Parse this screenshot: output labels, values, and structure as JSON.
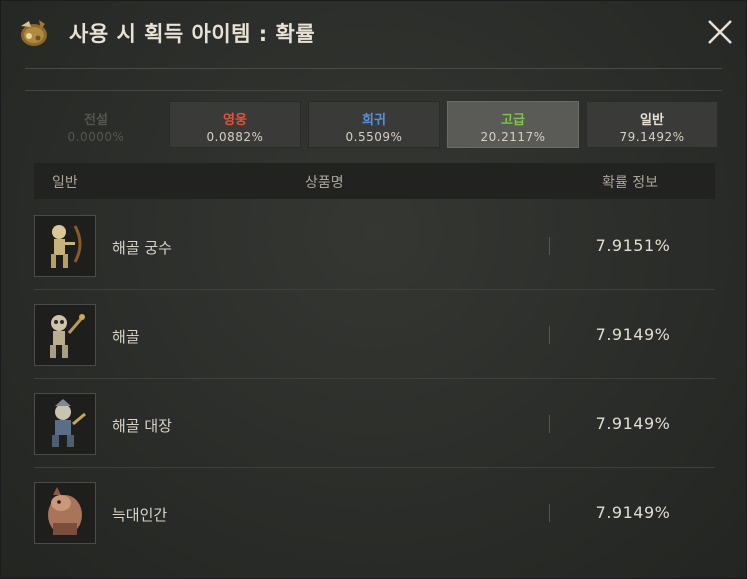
{
  "header": {
    "title": "사용 시 획득 아이템 : 확률",
    "icon": "item-bag-icon",
    "close_icon": "close-icon"
  },
  "tabs": [
    {
      "name": "전설",
      "pct": "0.0000%",
      "color": "#55564f",
      "state": "disabled"
    },
    {
      "name": "영웅",
      "pct": "0.0882%",
      "color": "#e0533a",
      "state": "normal"
    },
    {
      "name": "희귀",
      "pct": "0.5509%",
      "color": "#5a8fe0",
      "state": "normal"
    },
    {
      "name": "고급",
      "pct": "20.2117%",
      "color": "#7fc44d",
      "state": "active"
    },
    {
      "name": "일반",
      "pct": "79.1492%",
      "color": "#e6e1d3",
      "state": "normal"
    }
  ],
  "table": {
    "grade_label": "일반",
    "col_name": "상품명",
    "col_prob": "확률 정보",
    "rows": [
      {
        "name": "해골 궁수",
        "prob": "7.9151%",
        "icon": "skeleton-archer-icon"
      },
      {
        "name": "해골",
        "prob": "7.9149%",
        "icon": "skeleton-icon"
      },
      {
        "name": "해골 대장",
        "prob": "7.9149%",
        "icon": "skeleton-captain-icon"
      },
      {
        "name": "늑대인간",
        "prob": "7.9149%",
        "icon": "werewolf-icon"
      }
    ]
  }
}
